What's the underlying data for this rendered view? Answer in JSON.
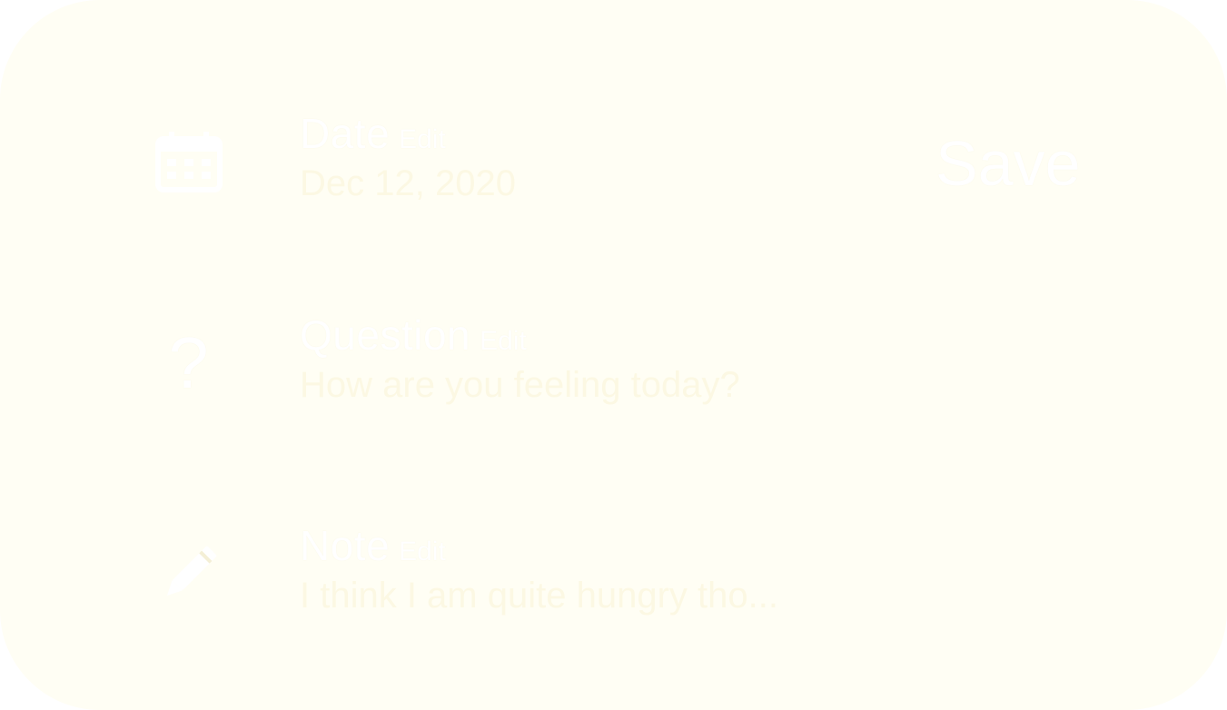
{
  "date": {
    "title": "Date",
    "edit_label": "Edit",
    "value": "Dec 12, 2020",
    "icon": "calendar-icon"
  },
  "question": {
    "title": "Question",
    "edit_label": "Edit",
    "value": "How are you feeling today?",
    "icon": "question-mark-icon",
    "icon_glyph": "?"
  },
  "note": {
    "title": "Note",
    "edit_label": "Edit",
    "value": "I think I am quite hungry tho...",
    "icon": "pencil-icon"
  },
  "save_label": "Save",
  "colors": {
    "card_background": "#fffef4",
    "text": "#ffffff",
    "value_text": "#fcf8e3"
  }
}
